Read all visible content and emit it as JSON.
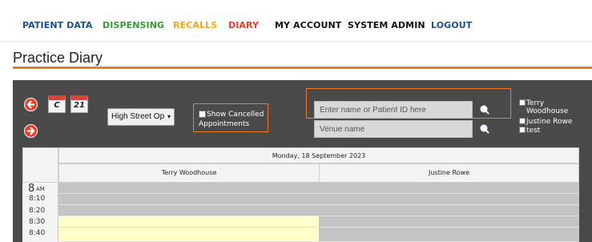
{
  "nav": {
    "items": [
      {
        "label": "PATIENT DATA",
        "color": "#1c4f8c"
      },
      {
        "label": "DISPENSING",
        "color": "#3a9a3a"
      },
      {
        "label": "RECALLS",
        "color": "#f5a623"
      },
      {
        "label": "DIARY",
        "color": "#e8402a"
      },
      {
        "label": "MY ACCOUNT",
        "color": "#111111"
      },
      {
        "label": "SYSTEM ADMIN",
        "color": "#111111"
      },
      {
        "label": "LOGOUT",
        "color": "#1c4f8c"
      }
    ]
  },
  "page": {
    "title": "Practice Diary",
    "accent": "#f07a2a"
  },
  "toolbar": {
    "prev_icon": "arrow-left-icon",
    "next_icon": "arrow-right-icon",
    "calendar_icon_1": "C",
    "calendar_icon_2": "21",
    "venue_select": "High Street Op",
    "show_cancelled_label": "Show Cancelled Appointments",
    "search_placeholder": "Enter name or Patient ID here",
    "venue_placeholder": "Venue name",
    "staff": [
      "Terry Woodhouse",
      "Justine Rowe",
      "test"
    ]
  },
  "calendar": {
    "date": "Monday, 18 September 2023",
    "practitioners": [
      "Terry Woodhouse",
      "Justine Rowe"
    ],
    "am_marker": "AM",
    "hour": "8",
    "times": [
      "8:10",
      "8:20",
      "8:30",
      "8:40"
    ],
    "slot_colors": {
      "unavailable": "#c4c4c4",
      "available": "#ffffcc"
    }
  }
}
